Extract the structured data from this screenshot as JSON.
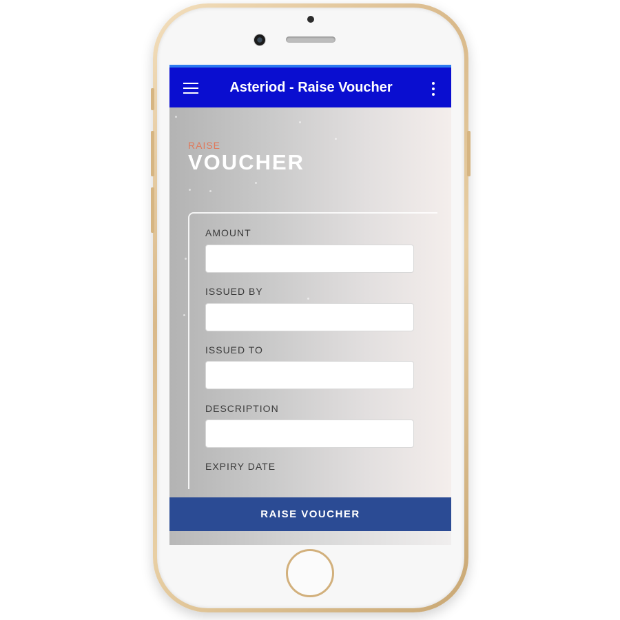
{
  "app": {
    "title": "Asteriod - Raise Voucher",
    "menu_icon": "hamburger-menu-icon",
    "overflow_icon": "more-vert-icon",
    "appbar_color": "#0a0ed0"
  },
  "page": {
    "heading_small": "RAISE",
    "heading_large": "VOUCHER",
    "accent_color": "#e0785a"
  },
  "form": {
    "fields": [
      {
        "label": "AMOUNT",
        "value": "",
        "placeholder": ""
      },
      {
        "label": "ISSUED BY",
        "value": "",
        "placeholder": ""
      },
      {
        "label": "ISSUED TO",
        "value": "",
        "placeholder": ""
      },
      {
        "label": "DESCRIPTION",
        "value": "",
        "placeholder": ""
      },
      {
        "label": "EXPIRY DATE"
      }
    ],
    "submit_label": "RAISE VOUCHER",
    "submit_color": "#2b4b94"
  }
}
